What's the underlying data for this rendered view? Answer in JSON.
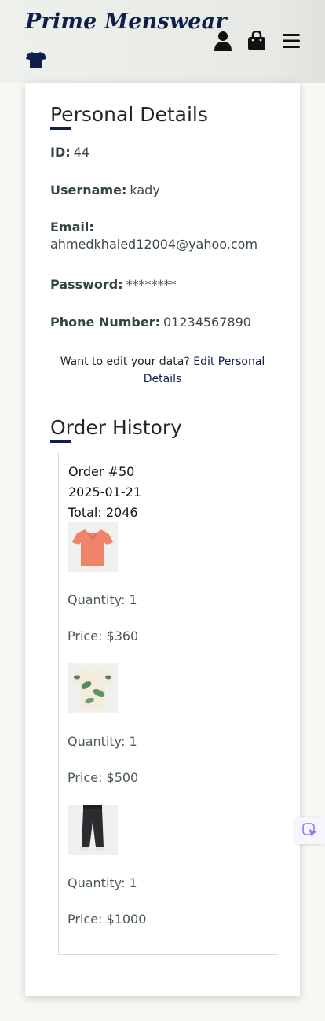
{
  "header": {
    "brand": "Prime Menswear",
    "icons": [
      "tshirt-icon",
      "user-icon",
      "shopping-bag-icon",
      "hamburger-menu-icon"
    ]
  },
  "personal_details": {
    "title": "Personal Details",
    "id_label": "ID:",
    "id_value": "44",
    "username_label": "Username:",
    "username_value": "kady",
    "email_label": "Email:",
    "email_value": "ahmedkhaled12004@yahoo.com",
    "password_label": "Password:",
    "password_value": "********",
    "phone_label": "Phone Number:",
    "phone_value": "01234567890",
    "edit_prompt": "Want to edit your data?",
    "edit_link": "Edit Personal Details"
  },
  "order_history": {
    "title": "Order History",
    "orders": [
      {
        "number": "Order #50",
        "date": "2025-01-21",
        "total": "Total: 2046",
        "items": [
          {
            "image": "coral-polo-shirt",
            "quantity": "Quantity: 1",
            "price": "Price: $360"
          },
          {
            "image": "tropical-print-shirt",
            "quantity": "Quantity: 1",
            "price": "Price: $500"
          },
          {
            "image": "black-jeans",
            "quantity": "Quantity: 1",
            "price": "Price: $1000"
          }
        ]
      }
    ]
  },
  "colors": {
    "brand_navy": "#0d1f4a",
    "header_bg": "#e7e9e4",
    "text": "#33403a"
  }
}
